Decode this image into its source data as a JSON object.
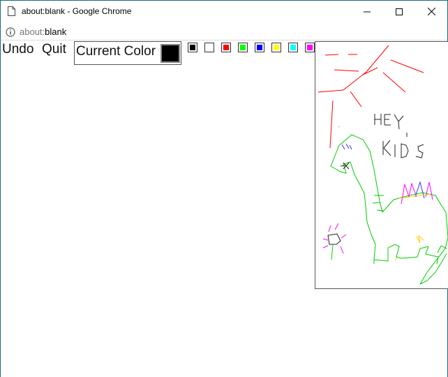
{
  "window": {
    "title": "about:blank - Google Chrome",
    "page_icon": "page-icon",
    "minimize_icon": "minimize-icon",
    "maximize_icon": "maximize-icon",
    "close_icon": "close-icon"
  },
  "address": {
    "info_icon": "info-icon",
    "url_scheme": "about:",
    "url_path": "blank"
  },
  "toolbar": {
    "undo_label": "Undo",
    "quit_label": "Quit",
    "current_color_label": "Current Color",
    "current_color": "#000000"
  },
  "palette": [
    {
      "name": "black",
      "color": "#000000"
    },
    {
      "name": "white",
      "color": "#ffffff"
    },
    {
      "name": "red",
      "color": "#ff0000"
    },
    {
      "name": "green",
      "color": "#00ff00"
    },
    {
      "name": "blue",
      "color": "#0000ff"
    },
    {
      "name": "yellow",
      "color": "#ffff00"
    },
    {
      "name": "cyan",
      "color": "#00ffff"
    },
    {
      "name": "magenta",
      "color": "#ff00ff"
    }
  ],
  "drawing": {
    "text_line_1": "HEY",
    "text_line_2": "KIDS"
  }
}
